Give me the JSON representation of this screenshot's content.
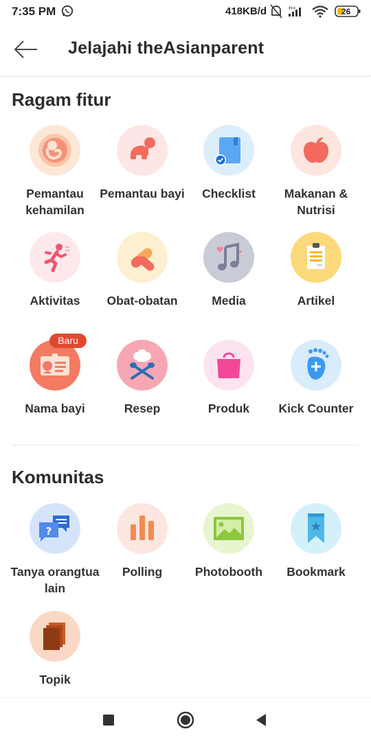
{
  "status_bar": {
    "time": "7:35 PM",
    "network_speed": "418KB/d",
    "battery": "26",
    "icons": [
      "whatsapp-icon",
      "mute-icon",
      "signal-icon",
      "wifi-icon",
      "battery-icon"
    ]
  },
  "app_bar": {
    "title": "Jelajahi theAsianparent",
    "back_icon": "arrow-left-icon"
  },
  "ragam_fitur": {
    "title": "Ragam fitur",
    "items": [
      {
        "label": "Pemantau kehamilan",
        "icon": "fetus-icon",
        "bg": "#fde7d6"
      },
      {
        "label": "Pemantau bayi",
        "icon": "crawling-baby-icon",
        "bg": "#fde6e4"
      },
      {
        "label": "Checklist",
        "icon": "checklist-icon",
        "bg": "#dceefc"
      },
      {
        "label": "Makanan & Nutrisi",
        "icon": "apple-icon",
        "bg": "#fde5e0"
      },
      {
        "label": "Aktivitas",
        "icon": "running-person-icon",
        "bg": "#fde8ec"
      },
      {
        "label": "Obat-obatan",
        "icon": "pills-icon",
        "bg": "#fdf0d0"
      },
      {
        "label": "Media",
        "icon": "music-note-icon",
        "bg": "#c9ccd6"
      },
      {
        "label": "Artikel",
        "icon": "clipboard-icon",
        "bg": "#fcd97a"
      },
      {
        "label": "Nama bayi",
        "icon": "name-card-icon",
        "bg": "#f47a62",
        "badge": "Baru"
      },
      {
        "label": "Resep",
        "icon": "chef-icon",
        "bg": "#f7a7b4"
      },
      {
        "label": "Produk",
        "icon": "shopping-bag-icon",
        "bg": "#fde3ef"
      },
      {
        "label": "Kick Counter",
        "icon": "footprint-icon",
        "bg": "#d8ecfb"
      }
    ]
  },
  "komunitas": {
    "title": "Komunitas",
    "items": [
      {
        "label": "Tanya orangtua lain",
        "icon": "chat-question-icon",
        "bg": "#d6e4fb"
      },
      {
        "label": "Polling",
        "icon": "bar-chart-icon",
        "bg": "#fde6e0"
      },
      {
        "label": "Photobooth",
        "icon": "image-icon",
        "bg": "#e8f6cf"
      },
      {
        "label": "Bookmark",
        "icon": "bookmark-icon",
        "bg": "#d4f1fb"
      },
      {
        "label": "Topik",
        "icon": "stacked-books-icon",
        "bg": "#fbd8c5"
      }
    ]
  },
  "nav_bar": {
    "buttons": [
      "recents-square-icon",
      "home-circle-icon",
      "back-triangle-icon"
    ]
  }
}
